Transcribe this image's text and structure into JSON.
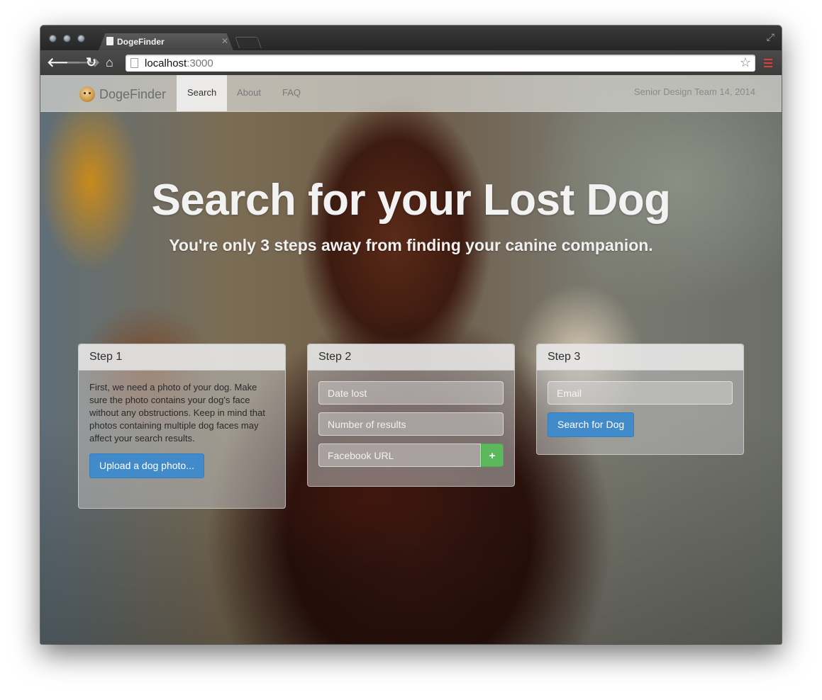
{
  "browser": {
    "tab_title": "DogeFinder",
    "url_host": "localhost",
    "url_port": ":3000",
    "icons": [
      "back-arrow-icon",
      "forward-arrow-icon",
      "reload-icon",
      "home-icon",
      "page-icon",
      "bookmark-star-icon",
      "chrome-menu-icon"
    ]
  },
  "navbar": {
    "brand": "DogeFinder",
    "items": [
      {
        "label": "Search",
        "active": true
      },
      {
        "label": "About",
        "active": false
      },
      {
        "label": "FAQ",
        "active": false
      }
    ],
    "right_text": "Senior Design Team 14, 2014"
  },
  "hero": {
    "title": "Search for your Lost Dog",
    "subtitle": "You're only 3 steps away from finding your canine companion."
  },
  "steps": [
    {
      "title": "Step 1",
      "text": "First, we need a photo of your dog. Make sure the photo contains your dog's face without any obstructions. Keep in mind that photos containing multiple dog faces may affect your search results.",
      "button": "Upload a dog photo..."
    },
    {
      "title": "Step 2",
      "date_placeholder": "Date lost",
      "results_placeholder": "Number of results",
      "facebook_placeholder": "Facebook URL",
      "add_label": "+"
    },
    {
      "title": "Step 3",
      "email_placeholder": "Email",
      "button": "Search for Dog"
    }
  ],
  "colors": {
    "primary": "#428bca",
    "success": "#5cb85c"
  }
}
